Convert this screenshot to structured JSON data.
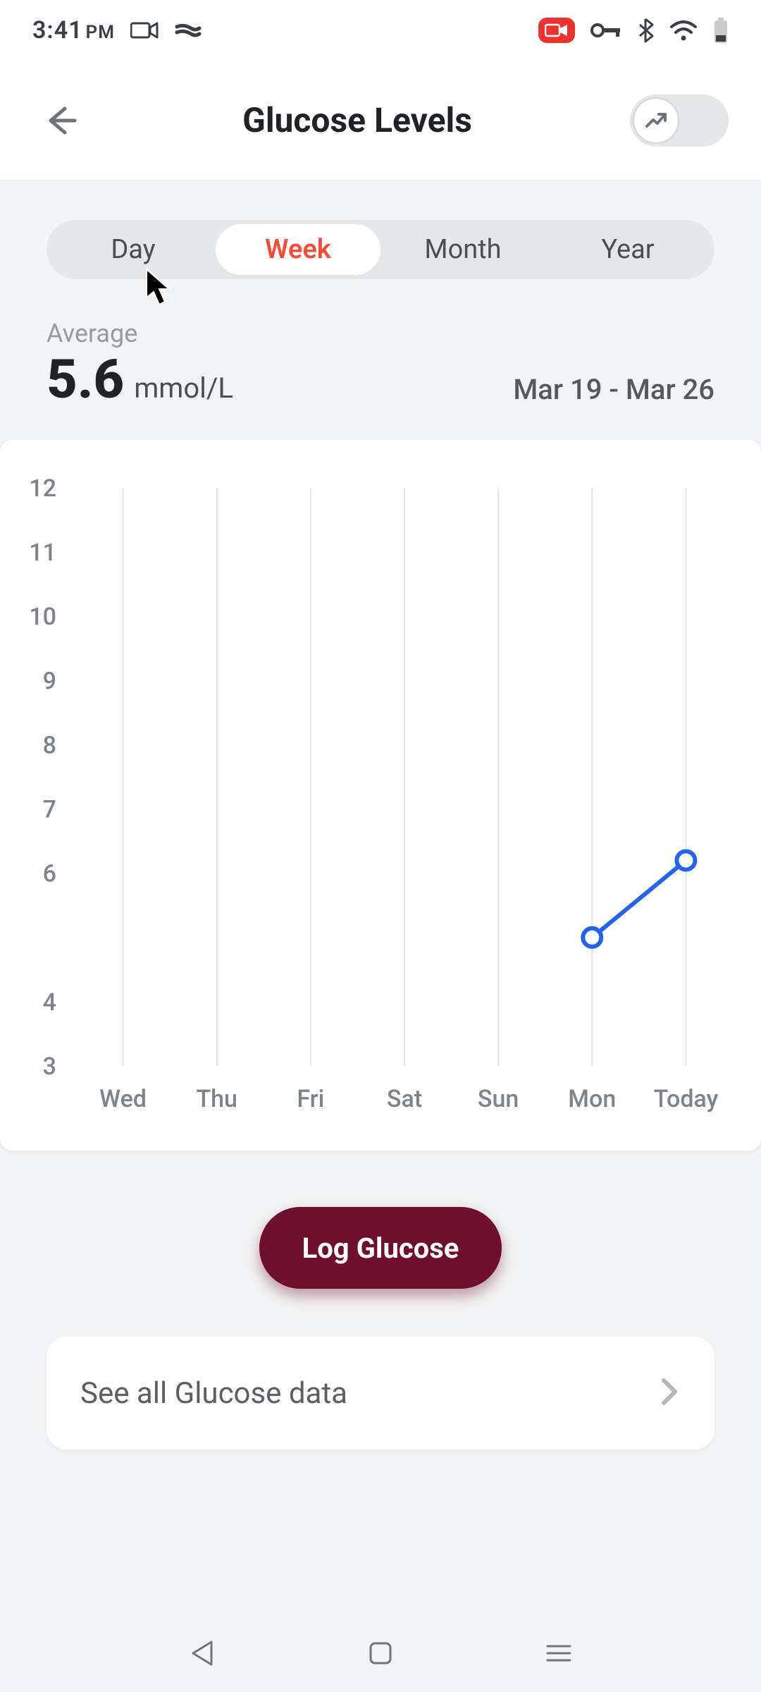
{
  "status_bar": {
    "time": "3:41",
    "ampm": "PM"
  },
  "header": {
    "title": "Glucose Levels"
  },
  "segments": {
    "day": "Day",
    "week": "Week",
    "month": "Month",
    "year": "Year",
    "active": "week"
  },
  "summary": {
    "average_label": "Average",
    "average_value": "5.6",
    "unit": "mmol/L",
    "date_range": "Mar 19 - Mar 26"
  },
  "cta": {
    "log_label": "Log Glucose"
  },
  "see_all": {
    "label": "See all Glucose data"
  },
  "chart_data": {
    "type": "line",
    "title": "",
    "xlabel": "",
    "ylabel": "",
    "unit": "mmol/L",
    "ylim": [
      3,
      12
    ],
    "y_ticks": [
      12,
      11,
      10,
      9,
      8,
      7,
      6,
      4,
      3
    ],
    "categories": [
      "Wed",
      "Thu",
      "Fri",
      "Sat",
      "Sun",
      "Mon",
      "Today"
    ],
    "series": [
      {
        "name": "Glucose",
        "color": "#2563eb",
        "values": [
          null,
          null,
          null,
          null,
          null,
          5.0,
          6.2
        ]
      }
    ]
  }
}
